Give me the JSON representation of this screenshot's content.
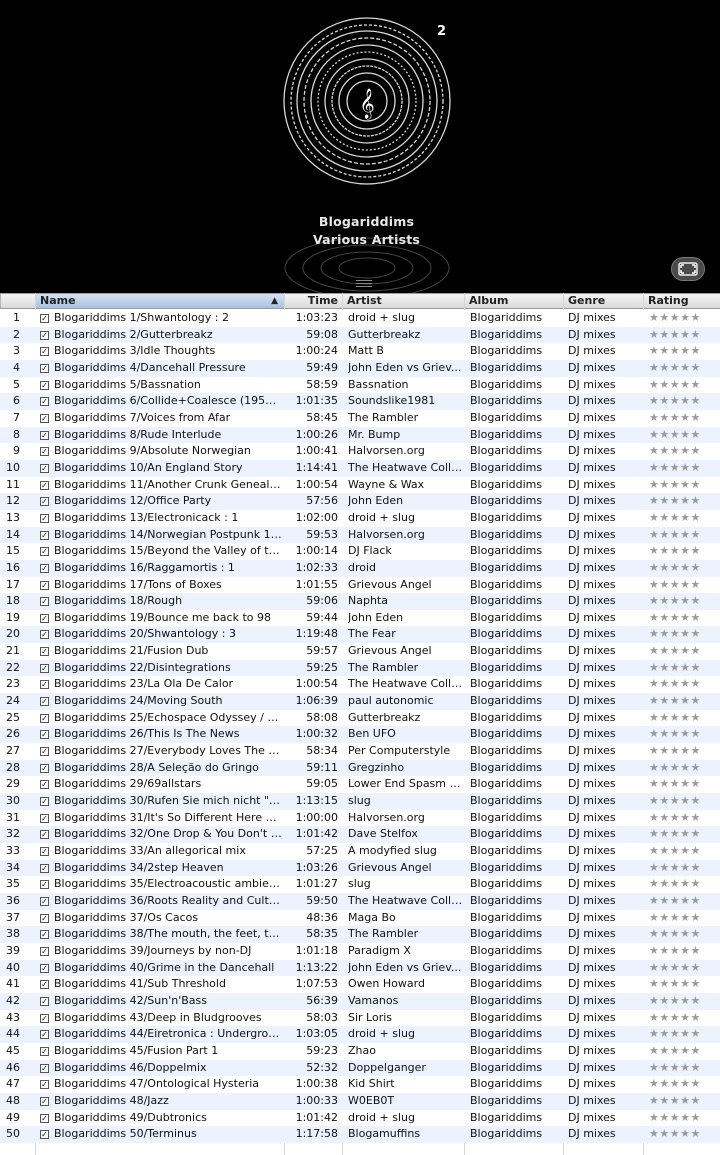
{
  "album_art": {
    "title": "Blogariddims",
    "artist": "Various Artists",
    "disc_number": "2",
    "icons": [
      "vinyl-disc-icon",
      "treble-clef-icon",
      "resize-grip-icon",
      "fullscreen-icon"
    ]
  },
  "columns": {
    "name": "Name",
    "time": "Time",
    "artist": "Artist",
    "album": "Album",
    "genre": "Genre",
    "rating": "Rating",
    "sort_indicator": "▲"
  },
  "colors": {
    "stripe": "#edf3fe",
    "header_sorted": "#a8c1e4",
    "background_art": "#000000"
  },
  "tracks": [
    {
      "num": "1",
      "name": "Blogariddims 1/Shwantology : 2",
      "time": "1:03:23",
      "artist": "droid + slug",
      "album": "Blogariddims",
      "genre": "DJ mixes",
      "rating": "★★★★★"
    },
    {
      "num": "2",
      "name": "Blogariddims 2/Gutterbreakz",
      "time": "59:08",
      "artist": "Gutterbreakz",
      "album": "Blogariddims",
      "genre": "DJ mixes",
      "rating": "★★★★★"
    },
    {
      "num": "3",
      "name": "Blogariddims 3/Idle Thoughts",
      "time": "1:00:24",
      "artist": "Matt B",
      "album": "Blogariddims",
      "genre": "DJ mixes",
      "rating": "★★★★★"
    },
    {
      "num": "4",
      "name": "Blogariddims 4/Dancehall Pressure",
      "time": "59:49",
      "artist": "John Eden vs Griev...",
      "album": "Blogariddims",
      "genre": "DJ mixes",
      "rating": "★★★★★"
    },
    {
      "num": "5",
      "name": "Blogariddims 5/Bassnation",
      "time": "58:59",
      "artist": "Bassnation",
      "album": "Blogariddims",
      "genre": "DJ mixes",
      "rating": "★★★★★"
    },
    {
      "num": "6",
      "name": "Blogariddims 6/Collide+Coalesce (1950-...",
      "time": "1:01:35",
      "artist": "Soundslike1981",
      "album": "Blogariddims",
      "genre": "DJ mixes",
      "rating": "★★★★★"
    },
    {
      "num": "7",
      "name": "Blogariddims 7/Voices from Afar",
      "time": "58:45",
      "artist": "The Rambler",
      "album": "Blogariddims",
      "genre": "DJ mixes",
      "rating": "★★★★★"
    },
    {
      "num": "8",
      "name": "Blogariddims 8/Rude Interlude",
      "time": "1:00:26",
      "artist": "Mr. Bump",
      "album": "Blogariddims",
      "genre": "DJ mixes",
      "rating": "★★★★★"
    },
    {
      "num": "9",
      "name": "Blogariddims 9/Absolute Norwegian",
      "time": "1:00:41",
      "artist": "Halvorsen.org",
      "album": "Blogariddims",
      "genre": "DJ mixes",
      "rating": "★★★★★"
    },
    {
      "num": "10",
      "name": "Blogariddims 10/An England Story",
      "time": "1:14:41",
      "artist": "The Heatwave Colle...",
      "album": "Blogariddims",
      "genre": "DJ mixes",
      "rating": "★★★★★"
    },
    {
      "num": "11",
      "name": "Blogariddims 11/Another Crunk Genealogy",
      "time": "1:00:54",
      "artist": "Wayne & Wax",
      "album": "Blogariddims",
      "genre": "DJ mixes",
      "rating": "★★★★★"
    },
    {
      "num": "12",
      "name": "Blogariddims 12/Office Party",
      "time": "57:56",
      "artist": "John Eden",
      "album": "Blogariddims",
      "genre": "DJ mixes",
      "rating": "★★★★★"
    },
    {
      "num": "13",
      "name": "Blogariddims 13/Electronicack : 1",
      "time": "1:02:00",
      "artist": "droid + slug",
      "album": "Blogariddims",
      "genre": "DJ mixes",
      "rating": "★★★★★"
    },
    {
      "num": "14",
      "name": "Blogariddims 14/Norwegian Postpunk 19...",
      "time": "59:53",
      "artist": "Halvorsen.org",
      "album": "Blogariddims",
      "genre": "DJ mixes",
      "rating": "★★★★★"
    },
    {
      "num": "15",
      "name": "Blogariddims 15/Beyond the Valley of th...",
      "time": "1:00:14",
      "artist": "DJ Flack",
      "album": "Blogariddims",
      "genre": "DJ mixes",
      "rating": "★★★★★"
    },
    {
      "num": "16",
      "name": "Blogariddims 16/Raggamortis : 1",
      "time": "1:02:33",
      "artist": "droid",
      "album": "Blogariddims",
      "genre": "DJ mixes",
      "rating": "★★★★★"
    },
    {
      "num": "17",
      "name": "Blogariddims 17/Tons of Boxes",
      "time": "1:01:55",
      "artist": "Grievous Angel",
      "album": "Blogariddims",
      "genre": "DJ mixes",
      "rating": "★★★★★"
    },
    {
      "num": "18",
      "name": "Blogariddims 18/Rough",
      "time": "59:06",
      "artist": "Naphta",
      "album": "Blogariddims",
      "genre": "DJ mixes",
      "rating": "★★★★★"
    },
    {
      "num": "19",
      "name": "Blogariddims 19/Bounce me back to 98",
      "time": "59:44",
      "artist": "John Eden",
      "album": "Blogariddims",
      "genre": "DJ mixes",
      "rating": "★★★★★"
    },
    {
      "num": "20",
      "name": "Blogariddims 20/Shwantology : 3",
      "time": "1:19:48",
      "artist": "The Fear",
      "album": "Blogariddims",
      "genre": "DJ mixes",
      "rating": "★★★★★"
    },
    {
      "num": "21",
      "name": "Blogariddims 21/Fusion Dub",
      "time": "59:57",
      "artist": "Grievous Angel",
      "album": "Blogariddims",
      "genre": "DJ mixes",
      "rating": "★★★★★"
    },
    {
      "num": "22",
      "name": "Blogariddims 22/Disintegrations",
      "time": "59:25",
      "artist": "The Rambler",
      "album": "Blogariddims",
      "genre": "DJ mixes",
      "rating": "★★★★★"
    },
    {
      "num": "23",
      "name": "Blogariddims 23/La Ola De Calor",
      "time": "1:00:54",
      "artist": "The Heatwave Colle...",
      "album": "Blogariddims",
      "genre": "DJ mixes",
      "rating": "★★★★★"
    },
    {
      "num": "24",
      "name": "Blogariddims 24/Moving South",
      "time": "1:06:39",
      "artist": "paul autonomic",
      "album": "Blogariddims",
      "genre": "DJ mixes",
      "rating": "★★★★★"
    },
    {
      "num": "25",
      "name": "Blogariddims 25/Echospace Odyssey / T...",
      "time": "58:08",
      "artist": "Gutterbreakz",
      "album": "Blogariddims",
      "genre": "DJ mixes",
      "rating": "★★★★★"
    },
    {
      "num": "26",
      "name": "Blogariddims 26/This Is The News",
      "time": "1:00:32",
      "artist": "Ben UFO",
      "album": "Blogariddims",
      "genre": "DJ mixes",
      "rating": "★★★★★"
    },
    {
      "num": "27",
      "name": "Blogariddims 27/Everybody Loves The Su...",
      "time": "58:34",
      "artist": "Per Computerstyle",
      "album": "Blogariddims",
      "genre": "DJ mixes",
      "rating": "★★★★★"
    },
    {
      "num": "28",
      "name": "Blogariddims 28/A Seleção do Gringo",
      "time": "59:11",
      "artist": "Gregzinho",
      "album": "Blogariddims",
      "genre": "DJ mixes",
      "rating": "★★★★★"
    },
    {
      "num": "29",
      "name": "Blogariddims 29/69allstars",
      "time": "59:05",
      "artist": "Lower End Spasm f...",
      "album": "Blogariddims",
      "genre": "DJ mixes",
      "rating": "★★★★★"
    },
    {
      "num": "30",
      "name": "Blogariddims 30/Rufen Sie mich nicht \"kr...",
      "time": "1:13:15",
      "artist": "slug",
      "album": "Blogariddims",
      "genre": "DJ mixes",
      "rating": "★★★★★"
    },
    {
      "num": "31",
      "name": "Blogariddims 31/It's So Different Here Vo...",
      "time": "1:00:00",
      "artist": "Halvorsen.org",
      "album": "Blogariddims",
      "genre": "DJ mixes",
      "rating": "★★★★★"
    },
    {
      "num": "32",
      "name": "Blogariddims 32/One Drop & You Don't S...",
      "time": "1:01:42",
      "artist": "Dave Stelfox",
      "album": "Blogariddims",
      "genre": "DJ mixes",
      "rating": "★★★★★"
    },
    {
      "num": "33",
      "name": "Blogariddims 33/An allegorical mix",
      "time": "57:25",
      "artist": "A modyfied slug",
      "album": "Blogariddims",
      "genre": "DJ mixes",
      "rating": "★★★★★"
    },
    {
      "num": "34",
      "name": "Blogariddims 34/2step Heaven",
      "time": "1:03:26",
      "artist": "Grievous Angel",
      "album": "Blogariddims",
      "genre": "DJ mixes",
      "rating": "★★★★★"
    },
    {
      "num": "35",
      "name": "Blogariddims 35/Electroacoustic ambien...",
      "time": "1:01:27",
      "artist": "slug",
      "album": "Blogariddims",
      "genre": "DJ mixes",
      "rating": "★★★★★"
    },
    {
      "num": "36",
      "name": "Blogariddims 36/Roots Reality and Culture",
      "time": "59:50",
      "artist": "The Heatwave Colle...",
      "album": "Blogariddims",
      "genre": "DJ mixes",
      "rating": "★★★★★"
    },
    {
      "num": "37",
      "name": "Blogariddims 37/Os Cacos",
      "time": "48:36",
      "artist": "Maga Bo",
      "album": "Blogariddims",
      "genre": "DJ mixes",
      "rating": "★★★★★"
    },
    {
      "num": "38",
      "name": "Blogariddims 38/The mouth, the feet, th...",
      "time": "58:35",
      "artist": "The Rambler",
      "album": "Blogariddims",
      "genre": "DJ mixes",
      "rating": "★★★★★"
    },
    {
      "num": "39",
      "name": "Blogariddims 39/Journeys by non-DJ",
      "time": "1:01:18",
      "artist": "Paradigm X",
      "album": "Blogariddims",
      "genre": "DJ mixes",
      "rating": "★★★★★"
    },
    {
      "num": "40",
      "name": "Blogariddims 40/Grime in the Dancehall",
      "time": "1:13:22",
      "artist": "John Eden vs Griev...",
      "album": "Blogariddims",
      "genre": "DJ mixes",
      "rating": "★★★★★"
    },
    {
      "num": "41",
      "name": "Blogariddims 41/Sub Threshold",
      "time": "1:07:53",
      "artist": "Owen Howard",
      "album": "Blogariddims",
      "genre": "DJ mixes",
      "rating": "★★★★★"
    },
    {
      "num": "42",
      "name": "Blogariddims 42/Sun'n'Bass",
      "time": "56:39",
      "artist": "Vamanos",
      "album": "Blogariddims",
      "genre": "DJ mixes",
      "rating": "★★★★★"
    },
    {
      "num": "43",
      "name": "Blogariddims 43/Deep in Bludgrooves",
      "time": "58:03",
      "artist": "Sir Loris",
      "album": "Blogariddims",
      "genre": "DJ mixes",
      "rating": "★★★★★"
    },
    {
      "num": "44",
      "name": "Blogariddims 44/Eiretronica : Underground",
      "time": "1:03:05",
      "artist": "droid + slug",
      "album": "Blogariddims",
      "genre": "DJ mixes",
      "rating": "★★★★★"
    },
    {
      "num": "45",
      "name": "Blogariddims 45/Fusion Part 1",
      "time": "59:23",
      "artist": "Zhao",
      "album": "Blogariddims",
      "genre": "DJ mixes",
      "rating": "★★★★★"
    },
    {
      "num": "46",
      "name": "Blogariddims 46/Doppelmix",
      "time": "52:32",
      "artist": "Doppelganger",
      "album": "Blogariddims",
      "genre": "DJ mixes",
      "rating": "★★★★★"
    },
    {
      "num": "47",
      "name": "Blogariddims 47/Ontological Hysteria",
      "time": "1:00:38",
      "artist": "Kid Shirt",
      "album": "Blogariddims",
      "genre": "DJ mixes",
      "rating": "★★★★★"
    },
    {
      "num": "48",
      "name": "Blogariddims 48/Jazz",
      "time": "1:00:33",
      "artist": "W0EB0T",
      "album": "Blogariddims",
      "genre": "DJ mixes",
      "rating": "★★★★★"
    },
    {
      "num": "49",
      "name": "Blogariddims 49/Dubtronics",
      "time": "1:01:42",
      "artist": "droid + slug",
      "album": "Blogariddims",
      "genre": "DJ mixes",
      "rating": "★★★★★"
    },
    {
      "num": "50",
      "name": "Blogariddims 50/Terminus",
      "time": "1:17:58",
      "artist": "Blogamuffins",
      "album": "Blogariddims",
      "genre": "DJ mixes",
      "rating": "★★★★★"
    }
  ]
}
